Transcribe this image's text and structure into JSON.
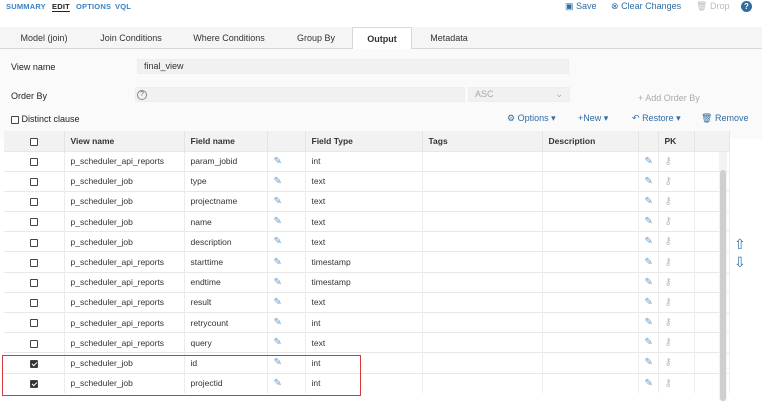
{
  "modes": [
    "SUMMARY",
    "EDIT",
    "OPTIONS",
    "VQL"
  ],
  "actions": {
    "save": "Save",
    "clear": "Clear Changes",
    "drop": "Drop",
    "help": "?"
  },
  "tabs": [
    "Model (join)",
    "Join Conditions",
    "Where Conditions",
    "Group By",
    "Output",
    "Metadata"
  ],
  "form": {
    "view_name_label": "View name",
    "view_name_value": "final_view",
    "order_by_label": "Order By",
    "order_dir": "ASC",
    "add_order_by": "+ Add Order By",
    "distinct_label": "Distinct clause"
  },
  "toolbar": {
    "options": "Options",
    "new": "New",
    "restore": "Restore",
    "remove": "Remove"
  },
  "columns": [
    "View name",
    "Field name",
    "Field Type",
    "Tags",
    "Description",
    "PK"
  ],
  "rows": [
    {
      "view": "p_scheduler_api_reports",
      "field": "param_jobid",
      "type": "int",
      "checked": false
    },
    {
      "view": "p_scheduler_job",
      "field": "type",
      "type": "text",
      "checked": false
    },
    {
      "view": "p_scheduler_job",
      "field": "projectname",
      "type": "text",
      "checked": false
    },
    {
      "view": "p_scheduler_job",
      "field": "name",
      "type": "text",
      "checked": false
    },
    {
      "view": "p_scheduler_job",
      "field": "description",
      "type": "text",
      "checked": false
    },
    {
      "view": "p_scheduler_api_reports",
      "field": "starttime",
      "type": "timestamp",
      "checked": false
    },
    {
      "view": "p_scheduler_api_reports",
      "field": "endtime",
      "type": "timestamp",
      "checked": false
    },
    {
      "view": "p_scheduler_api_reports",
      "field": "result",
      "type": "text",
      "checked": false
    },
    {
      "view": "p_scheduler_api_reports",
      "field": "retrycount",
      "type": "int",
      "checked": false
    },
    {
      "view": "p_scheduler_api_reports",
      "field": "query",
      "type": "text",
      "checked": false
    },
    {
      "view": "p_scheduler_job",
      "field": "id",
      "type": "int",
      "checked": true
    },
    {
      "view": "p_scheduler_job",
      "field": "projectid",
      "type": "int",
      "checked": true
    }
  ]
}
